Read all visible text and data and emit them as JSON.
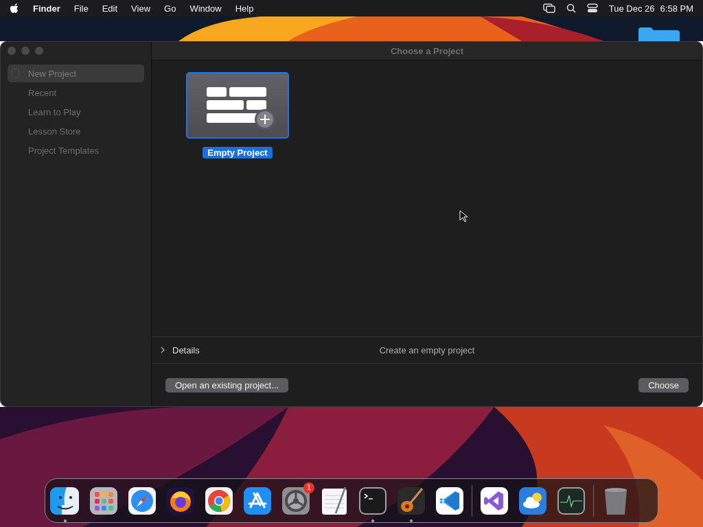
{
  "menu_bar": {
    "app_name": "Finder",
    "menus": [
      "File",
      "Edit",
      "View",
      "Go",
      "Window",
      "Help"
    ],
    "date": "Tue Dec 26",
    "time": "6:58 PM"
  },
  "window": {
    "title": "Choose a Project",
    "sidebar": {
      "items": [
        {
          "label": "New Project",
          "selected": true,
          "kind": "document"
        },
        {
          "label": "Recent",
          "selected": false,
          "kind": "plain"
        },
        {
          "label": "Learn to Play",
          "selected": false,
          "kind": "plain"
        },
        {
          "label": "Lesson Store",
          "selected": false,
          "kind": "plain"
        },
        {
          "label": "Project Templates",
          "selected": false,
          "kind": "plain"
        }
      ]
    },
    "projects": [
      {
        "label": "Empty Project",
        "selected": true
      }
    ],
    "details": {
      "label": "Details",
      "expanded": false,
      "description": "Create an empty project"
    },
    "buttons": [
      {
        "label": "Open an existing project..."
      },
      {
        "label": "Choose"
      }
    ]
  },
  "dock": {
    "sections": [
      [
        {
          "kind": "finder",
          "running": true
        },
        {
          "kind": "launchpad",
          "running": false
        },
        {
          "kind": "safari",
          "running": false
        },
        {
          "kind": "firefox",
          "running": false
        },
        {
          "kind": "chrome",
          "running": false
        },
        {
          "kind": "appstore",
          "running": false
        },
        {
          "kind": "settings",
          "running": false,
          "badge": "1"
        },
        {
          "kind": "textedit",
          "running": false
        },
        {
          "kind": "terminal",
          "running": true
        },
        {
          "kind": "garageband",
          "running": true
        },
        {
          "kind": "vscode",
          "running": false
        }
      ],
      [
        {
          "kind": "visualstudio",
          "running": false
        },
        {
          "kind": "weather",
          "running": false
        },
        {
          "kind": "activity",
          "running": false
        }
      ],
      [
        {
          "kind": "trash",
          "running": false
        }
      ]
    ]
  }
}
